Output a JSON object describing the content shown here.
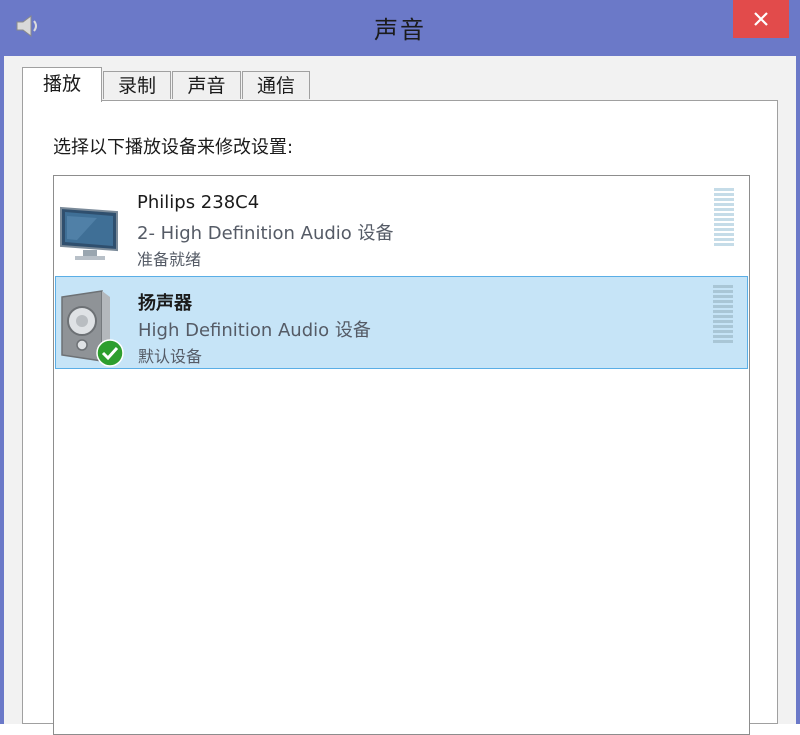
{
  "window": {
    "title": "声音",
    "close_glyph": "✕"
  },
  "tabs": [
    {
      "label": "播放",
      "active": true
    },
    {
      "label": "录制",
      "active": false
    },
    {
      "label": "声音",
      "active": false
    },
    {
      "label": "通信",
      "active": false
    }
  ],
  "playback": {
    "instruction": "选择以下播放设备来修改设置:",
    "devices": [
      {
        "name": "Philips 238C4",
        "description": "2- High Definition Audio 设备",
        "status": "准备就绪",
        "icon": "monitor-icon",
        "selected": false
      },
      {
        "name": "扬声器",
        "description": "High Definition Audio 设备",
        "status": "默认设备",
        "icon": "speaker-icon",
        "badge": "default-checkmark-icon",
        "selected": true
      }
    ]
  },
  "colors": {
    "titlebar": "#6b79c8",
    "close": "#e24b4b",
    "selection": "#c6e4f7",
    "selection_border": "#5aaee6",
    "check": "#2e9e2e"
  }
}
